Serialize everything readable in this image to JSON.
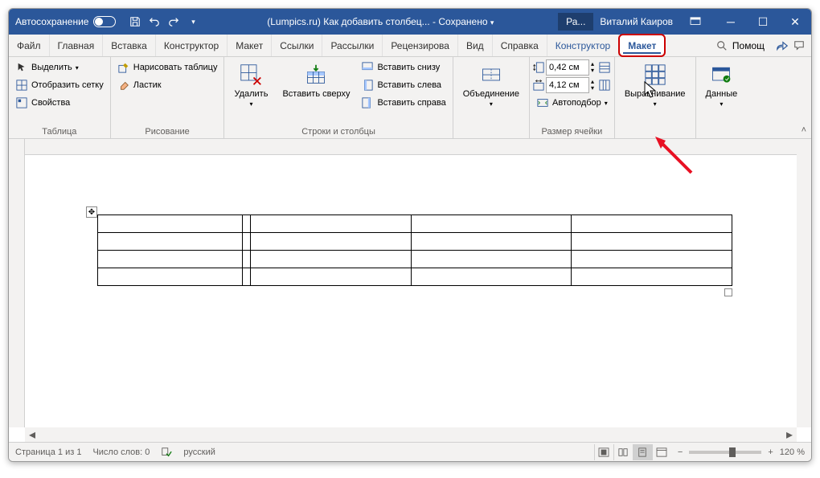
{
  "titlebar": {
    "autosave": "Автосохранение",
    "doc_title": "(Lumpics.ru) Как добавить столбец...",
    "saved_status": "Сохранено",
    "account_short": "Ра...",
    "username": "Виталий Каиров"
  },
  "tabs": {
    "file": "Файл",
    "home": "Главная",
    "insert": "Вставка",
    "design": "Конструктор",
    "layout": "Макет",
    "references": "Ссылки",
    "mailings": "Рассылки",
    "review": "Рецензирова",
    "view": "Вид",
    "help": "Справка",
    "table_design": "Конструктор",
    "table_layout": "Макет",
    "search_placeholder": "Помощ"
  },
  "ribbon": {
    "table_group": {
      "label": "Таблица",
      "select": "Выделить",
      "gridlines": "Отобразить сетку",
      "properties": "Свойства"
    },
    "draw_group": {
      "label": "Рисование",
      "draw": "Нарисовать таблицу",
      "eraser": "Ластик"
    },
    "rowscols_group": {
      "label": "Строки и столбцы",
      "delete": "Удалить",
      "insert_above": "Вставить сверху",
      "insert_below": "Вставить снизу",
      "insert_left": "Вставить слева",
      "insert_right": "Вставить справа"
    },
    "merge_group": {
      "label": "Объединение"
    },
    "cellsize_group": {
      "label": "Размер ячейки",
      "height": "0,42 см",
      "width": "4,12 см",
      "autofit": "Автоподбор"
    },
    "align_group": {
      "label": "Выравнивание"
    },
    "data_group": {
      "label": "Данные"
    }
  },
  "statusbar": {
    "page": "Страница 1 из 1",
    "words": "Число слов: 0",
    "language": "русский",
    "zoom": "120 %"
  }
}
